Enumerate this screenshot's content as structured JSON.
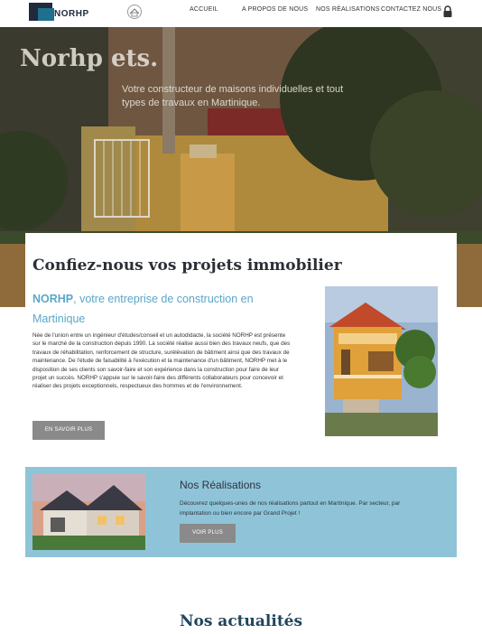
{
  "header": {
    "logo_text": "NORHP",
    "nav": [
      "ACCUEIL",
      "A PROPOS DE NOUS",
      "NOS RÉALISATIONS",
      "CONTACTEZ NOUS"
    ],
    "icons": {
      "emblem": "emblem-icon",
      "lock": "lock-icon"
    }
  },
  "hero": {
    "title": "Norhp ets.",
    "subtitle": "Votre constructeur de maisons individuelles et tout types de travaux en Martinique."
  },
  "intro": {
    "heading": "Confiez-nous vos projets immobilier",
    "brand": "NORHP",
    "tagline": ", votre entreprise de construction en Martinique",
    "paragraph": "Née de l'union entre un ingénieur d'études/conseil et un autodidacte, la société NORHP est présente sur le marché de la construction depuis 1990. La société réalise aussi bien des travaux neufs, que des travaux de réhabilitation, renforcement de structure, surélévation de bâtiment ainsi que des travaux de maintenance. De l'étude de faisabilité à l'exécution et la maintenance d'un bâtiment, NORHP met à le disposition de ses clients son savoir-faire et son expérience dans la construction pour faire de leur projet un succès. NORHP s'appuie sur le savoir-faire des différents collaborateurs pour concevoir et réaliser des projets exceptionnels, respectueux des hommes et de l'environnement.",
    "button": "EN SAVOIR PLUS"
  },
  "realisations": {
    "title": "Nos Réalisations",
    "text": "Découvrez quelques-unes de nos réalisations partout en Martinique. Par secteur, par implantation ou bien encore par Grand Projet !",
    "button": "VOIR PLUS"
  },
  "news": {
    "title": "Nos actualités"
  },
  "colors": {
    "accent": "#5aa7c8",
    "band": "#8fc4d8",
    "button": "#8a8a8a",
    "news_title": "#20455e"
  }
}
